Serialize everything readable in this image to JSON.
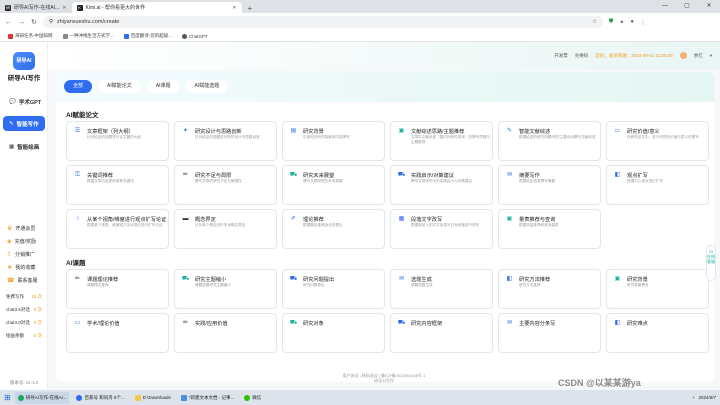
{
  "browser": {
    "tabs": [
      {
        "label": "研导AI写作-在线AI...",
        "active": false
      },
      {
        "label": "Kimi.ai - 帮你看更大的世界",
        "active": true
      }
    ],
    "url": "zhiyanxueshu.com/create",
    "bookmarks": [
      "海研任务-中国知网",
      "一种冲绳生活方式学...",
      "百度翻译-您的超级...",
      "ChatGPT"
    ]
  },
  "sidebar": {
    "logo": "研导AI",
    "brand": "研导AI写作",
    "nav": [
      {
        "label": "学术GPT",
        "active": false
      },
      {
        "label": "智能写作",
        "active": true
      },
      {
        "label": "智能绘画",
        "active": false
      }
    ],
    "menu": [
      "开通会员",
      "充值/奖励",
      "分销推广",
      "我的收藏",
      "联系客服"
    ],
    "quota": [
      {
        "label": "免费写作",
        "value": "10 次"
      },
      {
        "label": "chat3.5对话",
        "value": "0 次"
      },
      {
        "label": "chat4.0对话",
        "value": "0 次"
      },
      {
        "label": "绘画余额",
        "value": "0 次"
      }
    ],
    "version": "版本号: v2.1.0"
  },
  "topbar": {
    "items": [
      "开发票",
      "兑换码"
    ],
    "tip": "您好，会员到期：2024-09-01 11:00:06",
    "user": "余忆"
  },
  "category_tabs": [
    "全部",
    "AI赋能论文",
    "AI课题",
    "AI赋能选题"
  ],
  "sections": [
    {
      "title": "AI赋能论文",
      "cards": [
        {
          "title": "文章框架（列大纲）",
          "desc": "针对给定的选题进行论文篇的大纲",
          "icon": "doc-list-icon",
          "color": "#2f6df0"
        },
        {
          "title": "研究设计与思路创新",
          "desc": "针对给定的选题进行研究设计与思路创新",
          "icon": "idea-icon",
          "color": "#2f6df0"
        },
        {
          "title": "研究背景",
          "desc": "引用知识研究背景的内容撰写",
          "icon": "book-icon",
          "color": "#2f6df0"
        },
        {
          "title": "文献综述思路/主题推荐",
          "desc": "文章中文献综述（国内外研究现状）的撰写思路与主题推荐",
          "icon": "chat-icon",
          "color": "#1fb39c"
        },
        {
          "title": "智能文献综述",
          "desc": "根据给定的研究问题/研究主题自动撰写文献综述",
          "icon": "pen-icon",
          "color": "#2f6df0"
        },
        {
          "title": "研究价值/意义",
          "desc": "在研究论文中，关于研究的价值与意义的撰写",
          "icon": "screen-icon",
          "color": "#2f6df0"
        },
        {
          "title": "关键词推荐",
          "desc": "根据文章内容提炼推荐关键词",
          "icon": "key-icon",
          "color": "#2f6df0"
        },
        {
          "title": "研究不足与局限",
          "desc": "撰写文章的研究不足与局限性",
          "icon": "pencil-icon",
          "color": "#333333"
        },
        {
          "title": "研究未来展望",
          "desc": "撰写文章研究的未来展望",
          "icon": "car-icon",
          "color": "#1fb39c"
        },
        {
          "title": "实践启示/对策建议",
          "desc": "撰写文章研究中的实践启示与对策建议",
          "icon": "car-icon",
          "color": "#2f6df0"
        },
        {
          "title": "摘要写作",
          "desc": "根据给定信息撰写摘要",
          "icon": "mail-icon",
          "color": "#2f6df0"
        },
        {
          "title": "观点扩写",
          "desc": "根据中心观点进行扩写",
          "icon": "tag-icon",
          "color": "#2f6df0"
        },
        {
          "title": "从某个视角/维度进行观点扩写论证",
          "desc": "根据某个视角、维度或方法对观点进行扩写论证",
          "icon": "hand-icon",
          "color": "#2f6df0"
        },
        {
          "title": "概念界定",
          "desc": "针对某个概念进行学术概念界定",
          "icon": "folder-icon",
          "color": "#333333"
        },
        {
          "title": "理论推荐",
          "desc": "根据题目推荐适合的理论",
          "icon": "brush-icon",
          "color": "#2f6df0"
        },
        {
          "title": "段落文字改写",
          "desc": "根据新加入的文字信息对已有段落进行改写",
          "icon": "grid-icon",
          "color": "#2f6df0"
        },
        {
          "title": "量表推荐与查询",
          "desc": "根据变量推荐和查询量表",
          "icon": "chat-icon",
          "color": "#1fb39c"
        }
      ]
    },
    {
      "title": "AI课题",
      "cards": [
        {
          "title": "课题理论推荐",
          "desc": "课题理论推荐",
          "icon": "pencil-icon",
          "color": "#333333"
        },
        {
          "title": "研究主题缩小",
          "desc": "课题选题研究主题缩小",
          "icon": "car-icon",
          "color": "#1fb39c"
        },
        {
          "title": "研究问题提出",
          "desc": "研究问题提出",
          "icon": "car-icon",
          "color": "#2f6df0"
        },
        {
          "title": "选题生成",
          "desc": "课题选题生成",
          "icon": "mail-icon",
          "color": "#2f6df0"
        },
        {
          "title": "研究方法推荐",
          "desc": "研究方法推荐",
          "icon": "tag-icon",
          "color": "#2f6df0"
        },
        {
          "title": "研究背景",
          "desc": "研究背景撰写",
          "icon": "chat-icon",
          "color": "#1fb39c"
        },
        {
          "title": "学术/理论价值",
          "desc": "",
          "icon": "screen-icon",
          "color": "#2f6df0"
        },
        {
          "title": "实践/应用价值",
          "desc": "",
          "icon": "pencil-icon",
          "color": "#333333"
        },
        {
          "title": "研究对象",
          "desc": "",
          "icon": "car-icon",
          "color": "#1fb39c"
        },
        {
          "title": "研究内容框架",
          "desc": "",
          "icon": "car-icon",
          "color": "#2f6df0"
        },
        {
          "title": "主要内容分条写",
          "desc": "",
          "icon": "mail-icon",
          "color": "#2f6df0"
        },
        {
          "title": "研究难点",
          "desc": "",
          "icon": "tag-icon",
          "color": "#2f6df0"
        }
      ]
    }
  ],
  "footer": {
    "line1": "用户协议 | 隐私协议 | 鲁ICP备2023004158号-1",
    "line2": "研导AI写作"
  },
  "kefu": "在线客服",
  "taskbar": {
    "items": [
      "研导AI写作-在线AI...",
      "百家号 和同舟 8个...",
      "D:\\Downloads",
      "*新建文本文档 - 记事...",
      "微信"
    ],
    "time": "2024/6/7"
  },
  "watermark": "CSDN @以某某游ya"
}
